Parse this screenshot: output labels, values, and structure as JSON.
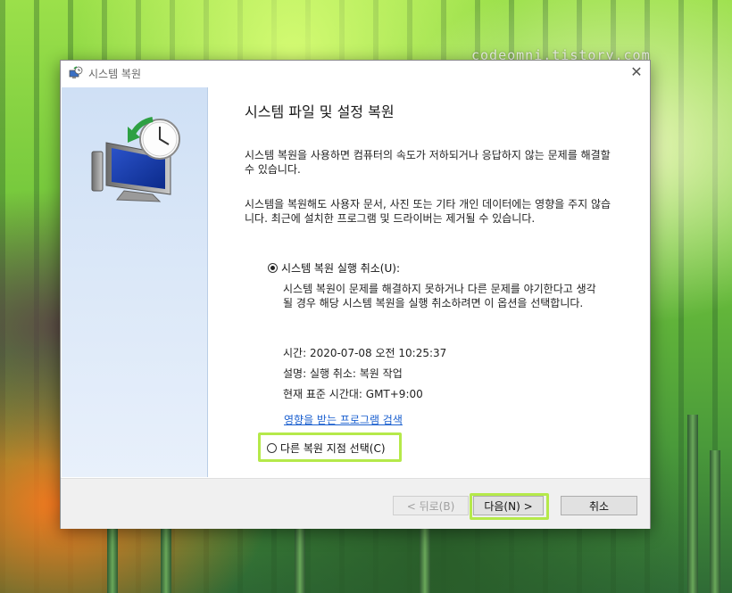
{
  "watermark": "codeomni.tistory.com",
  "dialog": {
    "title": "시스템 복원",
    "close_glyph": "✕"
  },
  "content": {
    "heading": "시스템 파일 및 설정 복원",
    "para1": "시스템 복원을 사용하면 컴퓨터의 속도가 저하되거나 응답하지 않는 문제를 해결할 수 있습니다.",
    "para2": "시스템을 복원해도 사용자 문서, 사진 또는 기타 개인 데이터에는 영향을 주지 않습니다. 최근에 설치한 프로그램 및 드라이버는 제거될 수 있습니다.",
    "undo_option": {
      "label": "시스템 복원 실행 취소(U):",
      "checked": true,
      "description": "시스템 복원이 문제를 해결하지 못하거나 다른 문제를 야기한다고 생각될 경우 해당 시스템 복원을 실행 취소하려면 이 옵션을 선택합니다.",
      "time": "시간: 2020-07-08 오전 10:25:37",
      "desc_line": "설명: 실행 취소: 복원 작업",
      "timezone": "현재 표준 시간대: GMT+9:00",
      "scan_link": "영향을 받는 프로그램 검색"
    },
    "other_option": {
      "label": "다른 복원 지점 선택(C)",
      "checked": false
    }
  },
  "footer": {
    "back_label": "< 뒤로(B)",
    "next_label": "다음(N) >",
    "cancel_label": "취소"
  },
  "colors": {
    "highlight": "#b5e94a",
    "link": "#1a5fcf",
    "side_panel": "#d6e5f7"
  },
  "icons": {
    "title": "system-restore-icon",
    "hero": "system-restore-monitor-clock-icon"
  }
}
